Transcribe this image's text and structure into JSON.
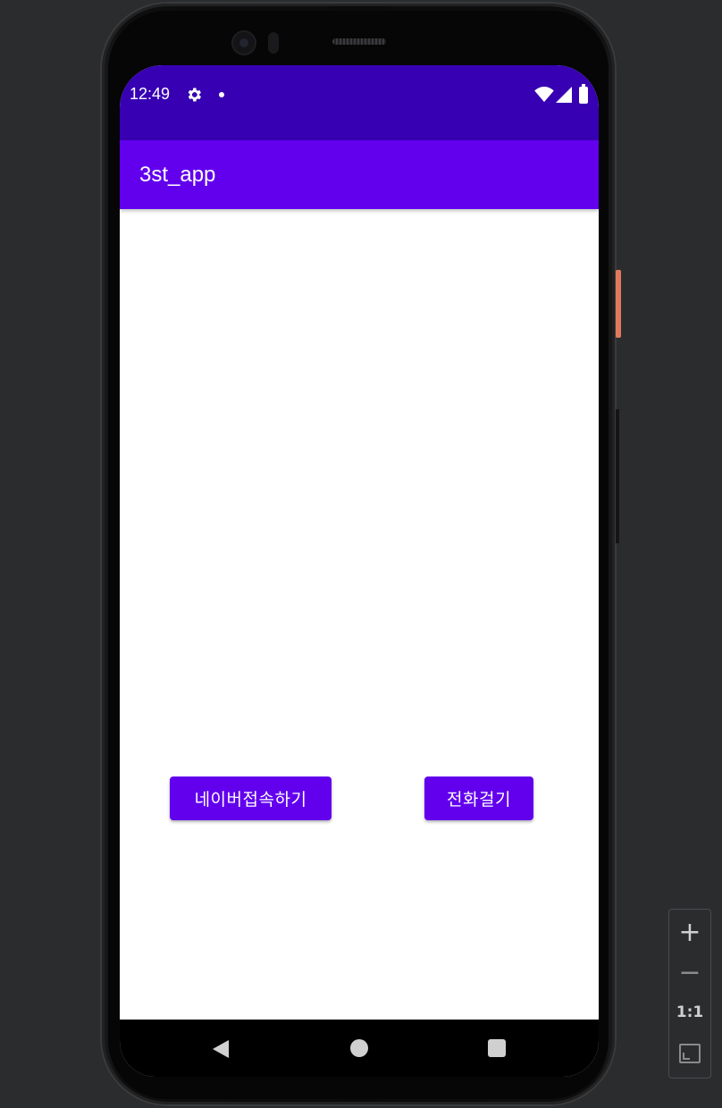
{
  "status_bar": {
    "time": "12:49",
    "icons": [
      "settings-gear-icon",
      "notification-dot-icon",
      "wifi-icon",
      "cellular-signal-icon",
      "battery-icon"
    ]
  },
  "app_bar": {
    "title": "3st_app",
    "background_color": "#6200ee",
    "status_bar_color": "#3700b3"
  },
  "main": {
    "buttons": [
      {
        "label": "네이버접속하기"
      },
      {
        "label": "전화걸기"
      }
    ]
  },
  "nav_bar": {
    "icons": [
      "back-icon",
      "home-icon",
      "recent-apps-icon"
    ]
  },
  "zoom_controls": {
    "zoom_in": "+",
    "zoom_out": "−",
    "actual_size": "1:1",
    "fit_icon": "fit-screen-icon"
  }
}
